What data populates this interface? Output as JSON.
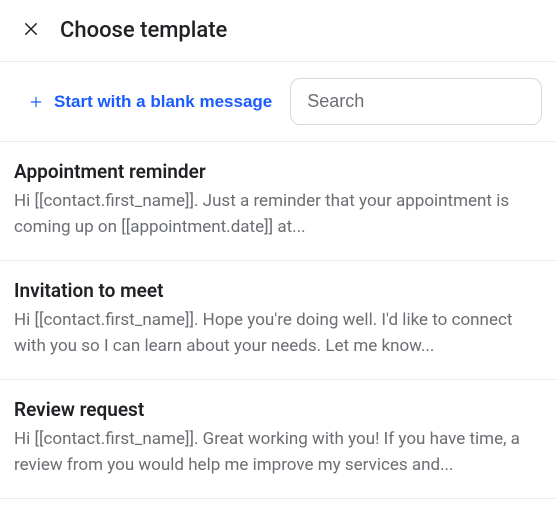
{
  "header": {
    "title": "Choose template"
  },
  "toolbar": {
    "blank_label": "Start with a blank message",
    "search_placeholder": "Search"
  },
  "templates": [
    {
      "title": "Appointment reminder",
      "preview": "Hi [[contact.first_name]]. Just a reminder that your appointment is coming up on [[appointment.date]] at..."
    },
    {
      "title": "Invitation to meet",
      "preview": "Hi [[contact.first_name]]. Hope you're doing well. I'd like to connect with you so I can learn about your needs. Let me know..."
    },
    {
      "title": "Review request",
      "preview": "Hi [[contact.first_name]]. Great working with you! If you have time, a review from you would help me improve my services and..."
    }
  ]
}
